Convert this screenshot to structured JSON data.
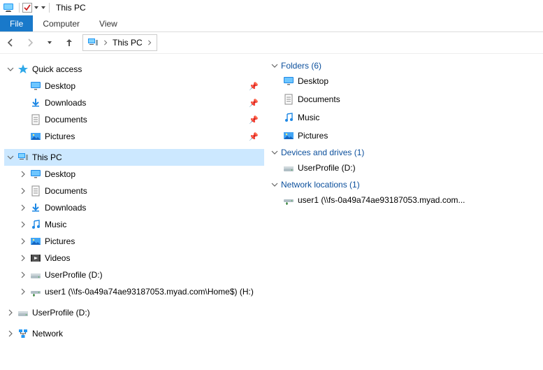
{
  "window_title": "This PC",
  "ribbon": {
    "file": "File",
    "tabs": [
      "Computer",
      "View"
    ]
  },
  "breadcrumb": {
    "location": "This PC"
  },
  "tree": {
    "quick_access": {
      "label": "Quick access",
      "items": [
        {
          "label": "Desktop",
          "icon": "desktop"
        },
        {
          "label": "Downloads",
          "icon": "downloads"
        },
        {
          "label": "Documents",
          "icon": "documents"
        },
        {
          "label": "Pictures",
          "icon": "pictures"
        }
      ]
    },
    "this_pc": {
      "label": "This PC",
      "items": [
        {
          "label": "Desktop",
          "icon": "desktop"
        },
        {
          "label": "Documents",
          "icon": "documents"
        },
        {
          "label": "Downloads",
          "icon": "downloads"
        },
        {
          "label": "Music",
          "icon": "music"
        },
        {
          "label": "Pictures",
          "icon": "pictures"
        },
        {
          "label": "Videos",
          "icon": "videos"
        },
        {
          "label": "UserProfile (D:)",
          "icon": "drive"
        },
        {
          "label": "user1 (\\\\fs-0a49a74ae93187053.myad.com\\Home$) (H:)",
          "icon": "netdrive"
        }
      ]
    },
    "userprofile": {
      "label": "UserProfile (D:)"
    },
    "network": {
      "label": "Network"
    }
  },
  "content": {
    "folders": {
      "label": "Folders (6)",
      "items": [
        {
          "label": "Desktop",
          "icon": "desktop"
        },
        {
          "label": "Documents",
          "icon": "documents"
        },
        {
          "label": "Music",
          "icon": "music"
        },
        {
          "label": "Pictures",
          "icon": "pictures"
        }
      ]
    },
    "drives": {
      "label": "Devices and drives (1)",
      "items": [
        {
          "label": "UserProfile (D:)",
          "icon": "drive"
        }
      ]
    },
    "network": {
      "label": "Network locations (1)",
      "items": [
        {
          "label": "user1 (\\\\fs-0a49a74ae93187053.myad.com...",
          "icon": "netdrive"
        }
      ]
    }
  }
}
